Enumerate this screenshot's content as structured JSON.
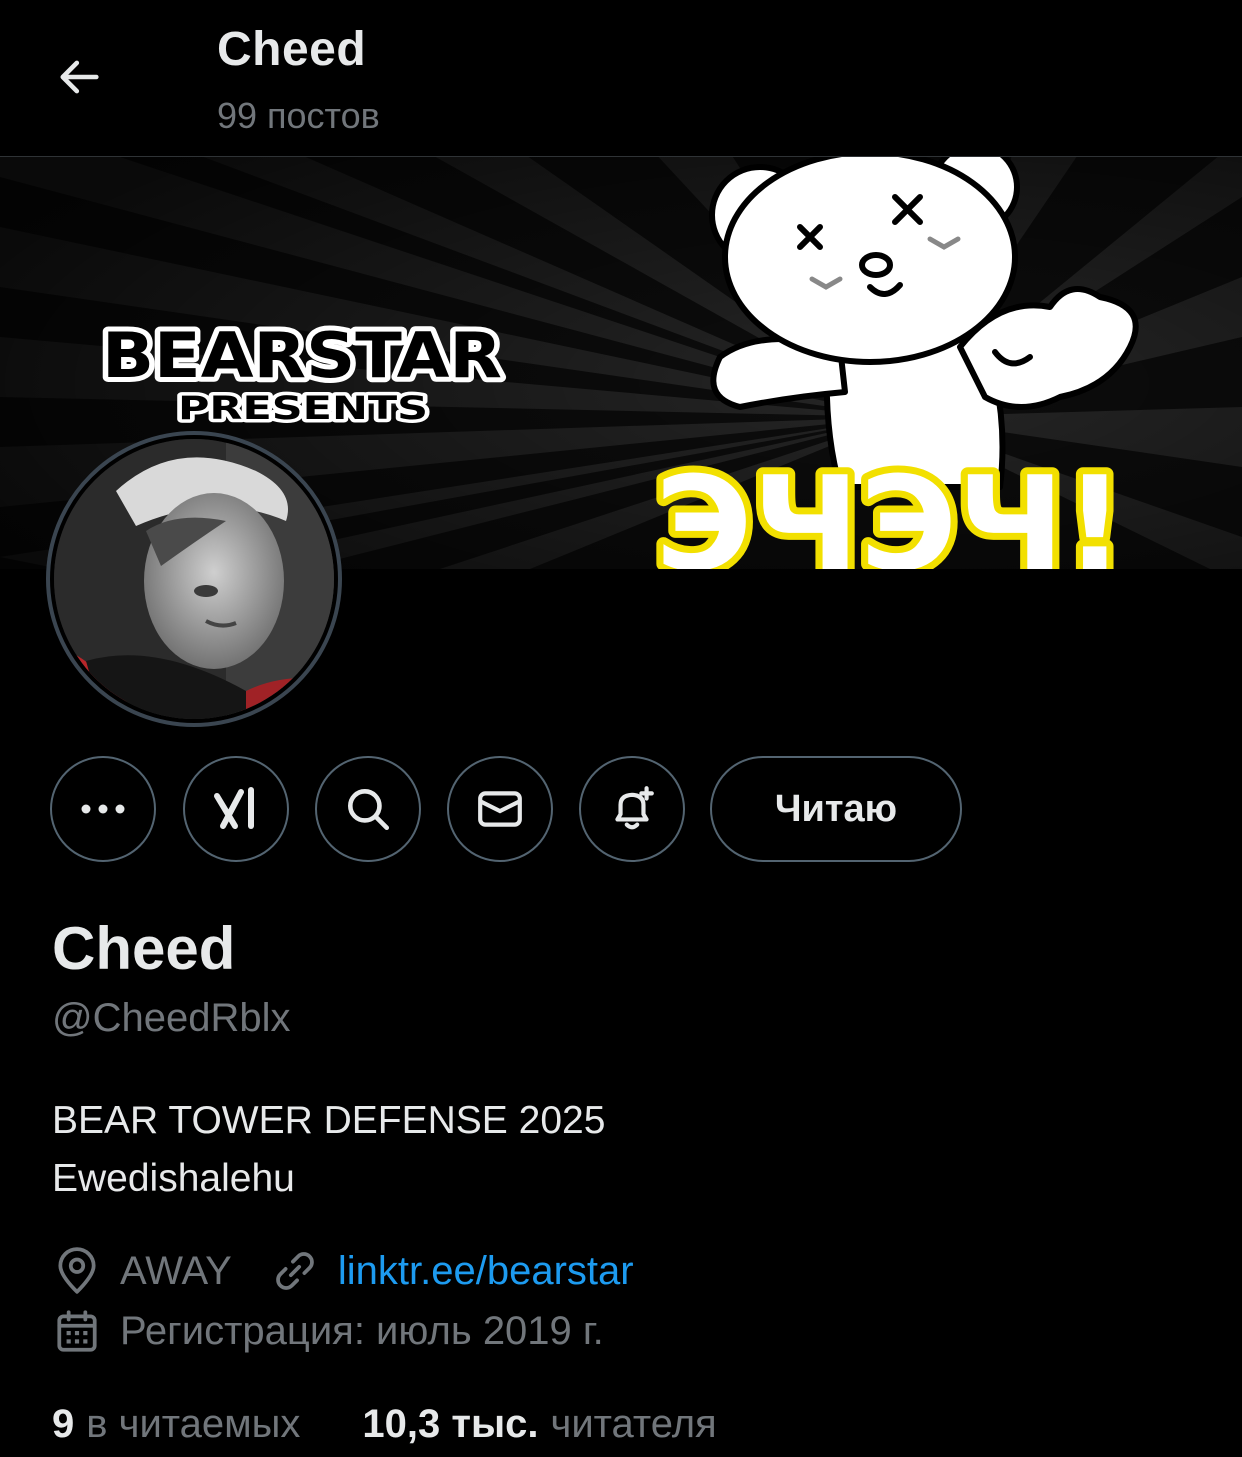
{
  "header": {
    "title": "Cheed",
    "posts_count": "99 постов"
  },
  "banner": {
    "title": "BEARSTAR",
    "subtitle": "PRESENTS",
    "logo_text": "ЭЧЭЧ!",
    "colors": {
      "accent_yellow": "#f2e000",
      "stripe_dark": "#111111",
      "stripe_light": "#2a2a2a"
    }
  },
  "actions": {
    "more_icon": "more-horizontal-icon",
    "grok_icon": "grok-icon",
    "search_icon": "search-icon",
    "message_icon": "envelope-icon",
    "notify_icon": "bell-plus-icon",
    "follow_label": "Читаю"
  },
  "profile": {
    "name": "Cheed",
    "handle": "@CheedRblx",
    "bio_line1": "BEAR TOWER DEFENSE 2025",
    "bio_line2": "Ewedishalehu",
    "location": "AWAY",
    "link": "linktr.ee/bearstar",
    "joined": "Регистрация: июль 2019 г."
  },
  "stats": {
    "following_count": "9",
    "following_label": "в читаемых",
    "followers_count": "10,3 тыс.",
    "followers_label": "читателя"
  },
  "colors": {
    "background": "#000000",
    "text_primary": "#e7e9ea",
    "text_secondary": "#71767b",
    "link": "#1d9bf0",
    "border": "#536471"
  }
}
